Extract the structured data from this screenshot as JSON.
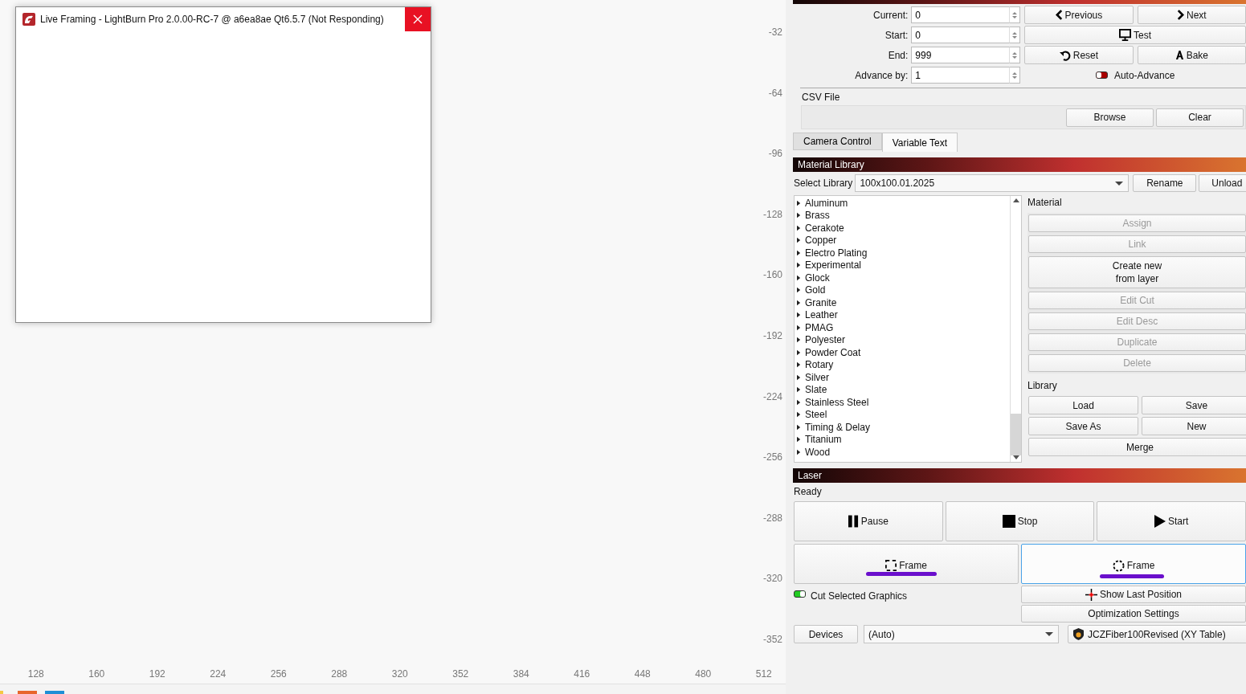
{
  "window": {
    "title": "Live Framing - LightBurn Pro 2.0.00-RC-7 @ a6ea8ae Qt6.5.7 (Not Responding)"
  },
  "canvas": {
    "y_ruler": [
      "-32",
      "-64",
      "-96",
      "-128",
      "-160",
      "-192",
      "-224",
      "-256",
      "-288",
      "-320",
      "-352"
    ],
    "x_ruler": [
      "128",
      "160",
      "192",
      "224",
      "256",
      "288",
      "320",
      "352",
      "384",
      "416",
      "448",
      "480",
      "512"
    ]
  },
  "variable_text": {
    "fields": [
      {
        "label": "Current:",
        "value": "0"
      },
      {
        "label": "Start:",
        "value": "0"
      },
      {
        "label": "End:",
        "value": "999"
      },
      {
        "label": "Advance by:",
        "value": "1"
      }
    ],
    "buttons": [
      {
        "label": "Previous",
        "kind": "previous"
      },
      {
        "label": "Next",
        "kind": "next"
      },
      {
        "label": "Test",
        "kind": "test"
      },
      {
        "label": "Reset",
        "kind": "reset"
      },
      {
        "label": "Bake",
        "kind": "bake"
      }
    ],
    "auto_advance": {
      "label": "Auto-Advance",
      "on": false
    },
    "csv_label": "CSV File",
    "csv_buttons": [
      "Browse",
      "Clear"
    ]
  },
  "tabs": [
    {
      "label": "Camera Control",
      "selected": false
    },
    {
      "label": "Variable Text",
      "selected": true
    }
  ],
  "material_library": {
    "title": "Material Library",
    "select_label": "Select Library",
    "library": "100x100.01.2025",
    "buttons": [
      "Rename",
      "Unload"
    ],
    "materials": [
      {
        "name": "Aluminum",
        "expanded": false
      },
      {
        "name": "Brass",
        "expanded": false
      },
      {
        "name": "Cerakote",
        "expanded": false
      },
      {
        "name": "Copper",
        "expanded": false
      },
      {
        "name": "Electro Plating",
        "expanded": false
      },
      {
        "name": "Experimental",
        "expanded": false
      },
      {
        "name": "Glock",
        "expanded": false
      },
      {
        "name": "Gold",
        "expanded": false
      },
      {
        "name": "Granite",
        "expanded": false
      },
      {
        "name": "Leather",
        "expanded": false
      },
      {
        "name": "PMAG",
        "expanded": false
      },
      {
        "name": "Polyester",
        "expanded": false
      },
      {
        "name": "Powder Coat",
        "expanded": false
      },
      {
        "name": "Rotary",
        "expanded": false
      },
      {
        "name": "Silver",
        "expanded": false
      },
      {
        "name": "Slate",
        "expanded": false
      },
      {
        "name": "Stainless Steel",
        "expanded": false
      },
      {
        "name": "Steel",
        "expanded": false
      },
      {
        "name": "Timing & Delay",
        "expanded": false
      },
      {
        "name": "Titanium",
        "expanded": false
      },
      {
        "name": "Wood",
        "expanded": false
      }
    ],
    "material_heading": "Material",
    "material_buttons": [
      {
        "label": "Assign",
        "disabled": true
      },
      {
        "label": "Link",
        "disabled": true
      },
      {
        "label": "Create new\nfrom layer",
        "disabled": false
      },
      {
        "label": "Edit Cut",
        "disabled": true
      },
      {
        "label": "Edit Desc",
        "disabled": true
      },
      {
        "label": "Duplicate",
        "disabled": true
      },
      {
        "label": "Delete",
        "disabled": true
      }
    ],
    "library_heading": "Library",
    "library_buttons": [
      "Load",
      "Save",
      "Save As",
      "New",
      "Merge"
    ]
  },
  "laser": {
    "title": "Laser",
    "status": "Ready",
    "buttons": [
      {
        "label": "Pause",
        "kind": "pause",
        "focused": false
      },
      {
        "label": "Stop",
        "kind": "stop",
        "focused": false
      },
      {
        "label": "Start",
        "kind": "start",
        "focused": false
      },
      {
        "label": "Frame",
        "kind": "frame_rect",
        "focused": false
      },
      {
        "label": "Frame",
        "kind": "frame_circle",
        "focused": true
      }
    ],
    "cut_selected": {
      "label": "Cut Selected Graphics",
      "on": true
    },
    "show_last_position": "Show Last Position",
    "optimization": "Optimization Settings",
    "devices": "Devices",
    "port": "(Auto)",
    "device": "JCZFiber100Revised (XY Table)"
  }
}
